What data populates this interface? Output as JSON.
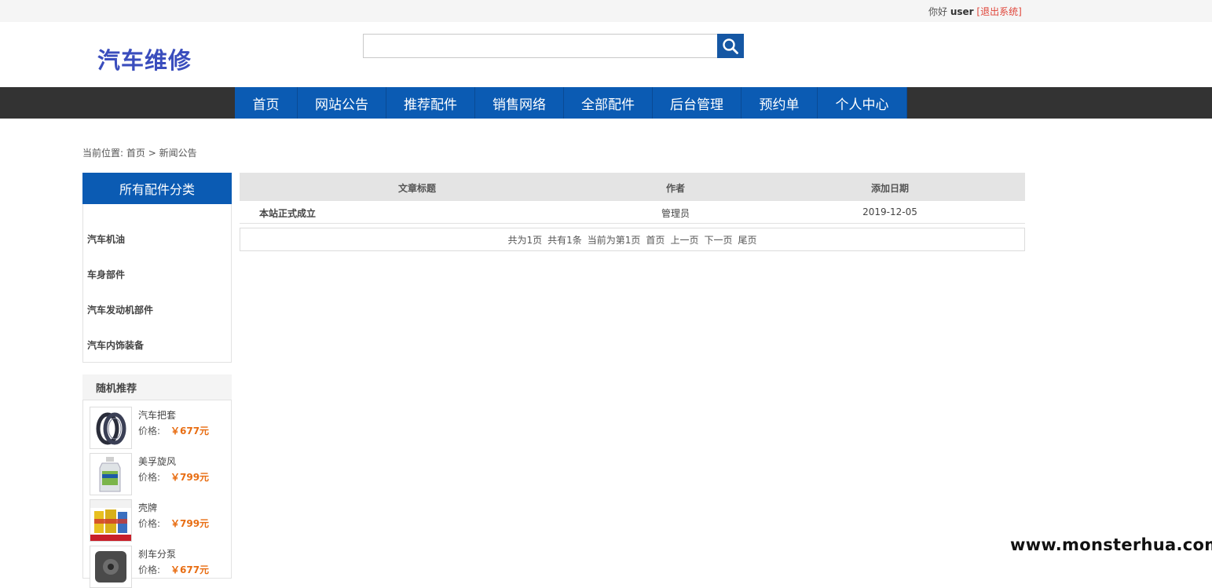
{
  "topbar": {
    "greeting": "你好",
    "username": "user",
    "logout": "[退出系统]"
  },
  "header": {
    "logo": "汽车维修",
    "search_value": "",
    "search_icon": "search-icon"
  },
  "nav": {
    "items": [
      "首页",
      "网站公告",
      "推荐配件",
      "销售网络",
      "全部配件",
      "后台管理",
      "预约单",
      "个人中心"
    ]
  },
  "breadcrumb": {
    "prefix": "当前位置:",
    "home": "首页",
    "sep": ">",
    "current": "新闻公告"
  },
  "sidebar": {
    "category_title": "所有配件分类",
    "categories": [
      "汽车机油",
      "车身部件",
      "汽车发动机部件",
      "汽车内饰装备"
    ],
    "recommend_title": "随机推荐",
    "price_label": "价格:",
    "recommend": [
      {
        "name": "汽车把套",
        "price": "￥677元"
      },
      {
        "name": "美孚旋风",
        "price": "￥799元"
      },
      {
        "name": "壳牌",
        "price": "￥799元"
      },
      {
        "name": "刹车分泵",
        "price": "￥677元"
      }
    ]
  },
  "table": {
    "headers": [
      "文章标题",
      "作者",
      "添加日期"
    ],
    "rows": [
      {
        "title": "本站正式成立",
        "author": "管理员",
        "date": "2019-12-05"
      }
    ]
  },
  "pager": {
    "total_pages": "共为1页",
    "total_items": "共有1条",
    "current_page": "当前为第1页",
    "first": "首页",
    "prev": "上一页",
    "next": "下一页",
    "last": "尾页"
  },
  "watermark": "www.monsterhua.com",
  "colors": {
    "nav_blue": "#0b5bb3",
    "nav_bar": "#333333",
    "logo": "#3a4dbd",
    "price": "#e86d12",
    "logout": "#e0463b"
  }
}
